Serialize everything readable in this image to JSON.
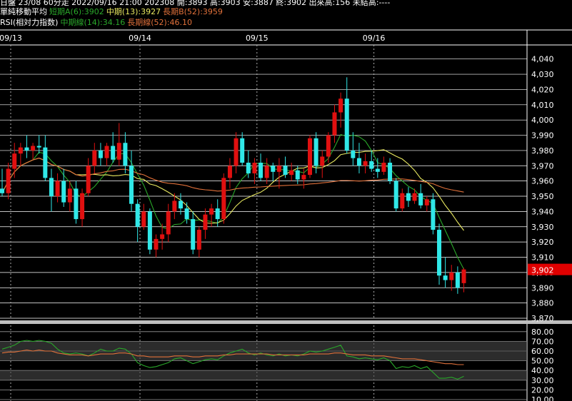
{
  "header": {
    "line1": "日盤 23/08 60分走 2022/09/16 21:00 202308 開:3893 高:3903 安:3887 終:3902 出來高:156 未結高:----",
    "ma_title": "單純移動平均",
    "ma_a": "短期A(6):3902",
    "ma_mid": "中期(13):3927",
    "ma_b": "長期B(52):3959",
    "rsi_title": "RSI(相対力指数)",
    "rsi_mid": "中期線(14):34.16",
    "rsi_long": "長期線(52):46.10"
  },
  "colors": {
    "background": "#000000",
    "up_candle": "#e01010",
    "down_candle": "#30e8e8",
    "ma_short": "#2aa82a",
    "ma_mid": "#e8e860",
    "ma_long": "#e0703a",
    "rsi_mid": "#2aa82a",
    "rsi_long": "#e0703a",
    "price_tag_bg": "#e00000",
    "grid": "#ffffff",
    "rsi_band": "#4a4a4a"
  },
  "chart_data": [
    {
      "type": "candlestick",
      "dates": [
        "09/13",
        "09/14",
        "09/15",
        "09/16"
      ],
      "ylim": [
        3870,
        4045
      ],
      "y_ticks": [
        "4,040",
        "4,030",
        "4,020",
        "4,010",
        "4,000",
        "3,990",
        "3,980",
        "3,970",
        "3,960",
        "3,950",
        "3,940",
        "3,930",
        "3,920",
        "3,910",
        "3,900",
        "3,890",
        "3,880",
        "3,870"
      ],
      "last_price_label": "3,902",
      "last_price": 3902,
      "candles": [
        [
          3955,
          3968,
          3950,
          3952
        ],
        [
          3952,
          3972,
          3948,
          3968
        ],
        [
          3968,
          3985,
          3962,
          3978
        ],
        [
          3978,
          3985,
          3970,
          3982
        ],
        [
          3982,
          3990,
          3975,
          3980
        ],
        [
          3980,
          3985,
          3974,
          3983
        ],
        [
          3983,
          3990,
          3978,
          3982
        ],
        [
          3982,
          3990,
          3960,
          3962
        ],
        [
          3962,
          3968,
          3940,
          3950
        ],
        [
          3950,
          3965,
          3946,
          3960
        ],
        [
          3960,
          3968,
          3943,
          3946
        ],
        [
          3946,
          3960,
          3940,
          3955
        ],
        [
          3955,
          3960,
          3932,
          3935
        ],
        [
          3935,
          3955,
          3930,
          3952
        ],
        [
          3952,
          3975,
          3950,
          3970
        ],
        [
          3970,
          3985,
          3965,
          3980
        ],
        [
          3980,
          3985,
          3970,
          3975
        ],
        [
          3975,
          3985,
          3970,
          3983
        ],
        [
          3983,
          3992,
          3972,
          3974
        ],
        [
          3974,
          3998,
          3970,
          3985
        ],
        [
          3985,
          3992,
          3965,
          3970
        ],
        [
          3970,
          3980,
          3940,
          3945
        ],
        [
          3945,
          3948,
          3920,
          3930
        ],
        [
          3930,
          3945,
          3928,
          3940
        ],
        [
          3940,
          3942,
          3912,
          3915
        ],
        [
          3915,
          3925,
          3910,
          3922
        ],
        [
          3922,
          3932,
          3915,
          3925
        ],
        [
          3925,
          3945,
          3920,
          3940
        ],
        [
          3940,
          3952,
          3935,
          3947
        ],
        [
          3947,
          3952,
          3938,
          3942
        ],
        [
          3942,
          3946,
          3932,
          3935
        ],
        [
          3935,
          3940,
          3912,
          3915
        ],
        [
          3915,
          3930,
          3910,
          3928
        ],
        [
          3928,
          3942,
          3922,
          3938
        ],
        [
          3938,
          3945,
          3930,
          3942
        ],
        [
          3942,
          3948,
          3930,
          3935
        ],
        [
          3935,
          3965,
          3932,
          3962
        ],
        [
          3962,
          3975,
          3955,
          3970
        ],
        [
          3970,
          3992,
          3965,
          3988
        ],
        [
          3988,
          3992,
          3970,
          3972
        ],
        [
          3972,
          3980,
          3962,
          3965
        ],
        [
          3965,
          3975,
          3958,
          3972
        ],
        [
          3972,
          3978,
          3960,
          3962
        ],
        [
          3962,
          3975,
          3958,
          3970
        ],
        [
          3970,
          3972,
          3960,
          3966
        ],
        [
          3966,
          3975,
          3955,
          3970
        ],
        [
          3970,
          3976,
          3962,
          3964
        ],
        [
          3964,
          3972,
          3960,
          3967
        ],
        [
          3967,
          3970,
          3958,
          3961
        ],
        [
          3961,
          3968,
          3955,
          3964
        ],
        [
          3964,
          3990,
          3962,
          3988
        ],
        [
          3988,
          3992,
          3965,
          3970
        ],
        [
          3970,
          3980,
          3962,
          3976
        ],
        [
          3976,
          3992,
          3972,
          3990
        ],
        [
          3990,
          4010,
          3985,
          4005
        ],
        [
          4005,
          4018,
          3995,
          4014
        ],
        [
          4014,
          4028,
          3978,
          3980
        ],
        [
          3980,
          3992,
          3970,
          3975
        ],
        [
          3975,
          3985,
          3965,
          3970
        ],
        [
          3970,
          3978,
          3965,
          3973
        ],
        [
          3973,
          3980,
          3966,
          3968
        ],
        [
          3968,
          3975,
          3962,
          3966
        ],
        [
          3966,
          3976,
          3964,
          3972
        ],
        [
          3972,
          3975,
          3958,
          3960
        ],
        [
          3960,
          3962,
          3940,
          3942
        ],
        [
          3942,
          3955,
          3940,
          3952
        ],
        [
          3952,
          3956,
          3943,
          3947
        ],
        [
          3947,
          3955,
          3945,
          3952
        ],
        [
          3952,
          3958,
          3942,
          3944
        ],
        [
          3944,
          3950,
          3940,
          3948
        ],
        [
          3948,
          3952,
          3925,
          3928
        ],
        [
          3928,
          3932,
          3892,
          3898
        ],
        [
          3898,
          3910,
          3890,
          3895
        ],
        [
          3895,
          3905,
          3888,
          3900
        ],
        [
          3900,
          3904,
          3886,
          3890
        ],
        [
          3893,
          3903,
          3887,
          3902
        ]
      ]
    },
    {
      "type": "line",
      "name": "RSI",
      "ylim": [
        10,
        85
      ],
      "y_ticks": [
        "80.00",
        "70.00",
        "60.00",
        "50.00",
        "40.00",
        "30.00",
        "20.00",
        "10.00"
      ],
      "series": [
        {
          "values": [
            62,
            64,
            66,
            70,
            71,
            70,
            71,
            70,
            68,
            62,
            58,
            57,
            58,
            57,
            55,
            58,
            62,
            60,
            60,
            63,
            62,
            57,
            48,
            45,
            43,
            44,
            46,
            48,
            52,
            53,
            50,
            47,
            49,
            51,
            52,
            51,
            55,
            58,
            60,
            62,
            58,
            56,
            58,
            56,
            55,
            57,
            55,
            56,
            55,
            57,
            60,
            59,
            60,
            62,
            64,
            66,
            55,
            54,
            52,
            53,
            52,
            51,
            53,
            50,
            42,
            44,
            43,
            45,
            42,
            44,
            38,
            32,
            32,
            33,
            31,
            34
          ]
        },
        {
          "values": [
            58,
            59,
            59,
            60,
            61,
            60,
            61,
            60,
            60,
            58,
            57,
            56,
            56,
            56,
            55,
            56,
            57,
            57,
            57,
            58,
            58,
            57,
            55,
            55,
            54,
            54,
            54,
            54,
            55,
            55,
            55,
            54,
            54,
            55,
            55,
            55,
            56,
            56,
            57,
            57,
            57,
            57,
            57,
            57,
            56,
            56,
            56,
            56,
            56,
            56,
            57,
            57,
            57,
            57,
            58,
            58,
            57,
            56,
            56,
            56,
            55,
            55,
            55,
            54,
            53,
            52,
            52,
            52,
            51,
            50,
            49,
            48,
            47,
            47,
            46,
            46
          ]
        }
      ]
    }
  ]
}
